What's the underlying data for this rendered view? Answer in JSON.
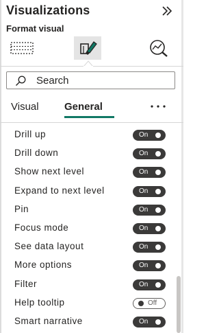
{
  "pane": {
    "title": "Visualizations",
    "subtitle": "Format visual",
    "collapse_icon": "double-chevron-right-icon"
  },
  "pane_tabs": [
    {
      "name": "build-visual",
      "icon": "build-visual-grid-icon",
      "selected": false
    },
    {
      "name": "format-visual",
      "icon": "format-brush-icon",
      "selected": true
    },
    {
      "name": "analytics",
      "icon": "analytics-magnifier-icon",
      "selected": false
    }
  ],
  "search": {
    "placeholder": "Search",
    "icon": "search-icon"
  },
  "tabs": [
    {
      "label": "Visual",
      "selected": false
    },
    {
      "label": "General",
      "selected": true
    }
  ],
  "more_icon": "ellipsis-icon",
  "toggles": [
    {
      "label": "Drill up",
      "state": "On"
    },
    {
      "label": "Drill down",
      "state": "On"
    },
    {
      "label": "Show next level",
      "state": "On"
    },
    {
      "label": "Expand to next level",
      "state": "On"
    },
    {
      "label": "Pin",
      "state": "On"
    },
    {
      "label": "Focus mode",
      "state": "On"
    },
    {
      "label": "See data layout",
      "state": "On"
    },
    {
      "label": "More options",
      "state": "On"
    },
    {
      "label": "Filter",
      "state": "On"
    },
    {
      "label": "Help tooltip",
      "state": "Off"
    },
    {
      "label": "Smart narrative",
      "state": "On"
    }
  ],
  "colors": {
    "accent": "#117865",
    "toggle_on": "#3b3a39",
    "text": "#252423"
  }
}
